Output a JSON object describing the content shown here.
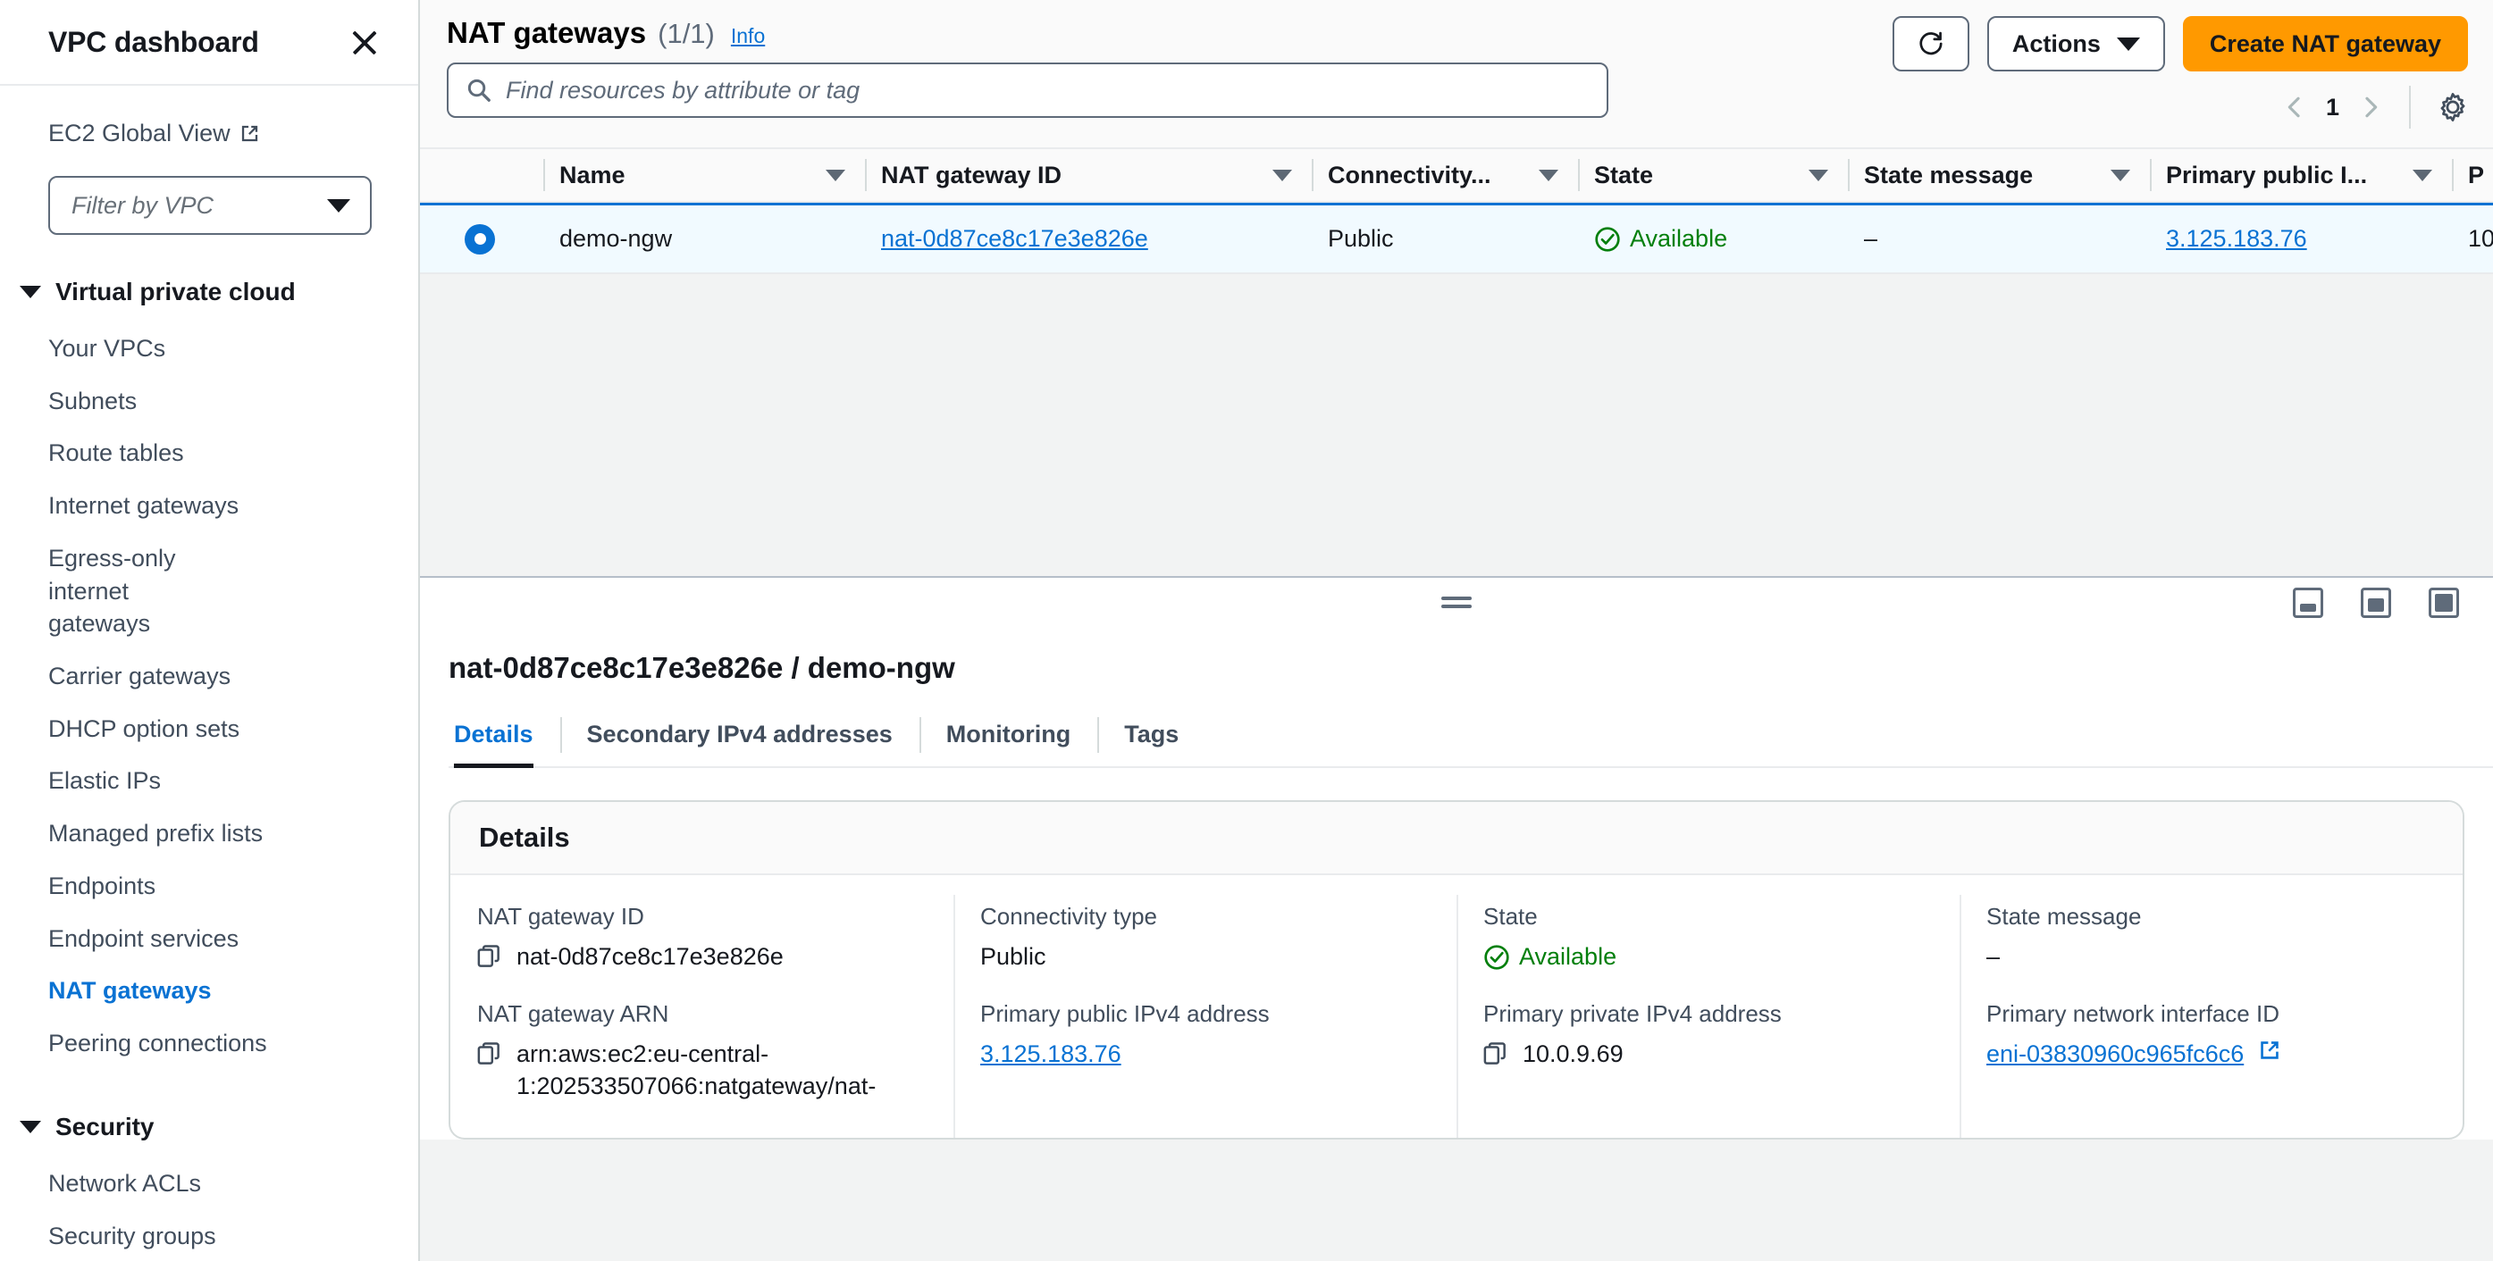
{
  "sidebar": {
    "title": "VPC dashboard",
    "close_label": "Close",
    "global_view": "EC2 Global View",
    "vpc_filter_placeholder": "Filter by VPC",
    "groups": [
      {
        "label": "Virtual private cloud",
        "items": [
          "Your VPCs",
          "Subnets",
          "Route tables",
          "Internet gateways",
          "Egress-only internet gateways",
          "Carrier gateways",
          "DHCP option sets",
          "Elastic IPs",
          "Managed prefix lists",
          "Endpoints",
          "Endpoint services",
          "NAT gateways",
          "Peering connections"
        ],
        "active": "NAT gateways"
      },
      {
        "label": "Security",
        "items": [
          "Network ACLs",
          "Security groups"
        ],
        "active": ""
      }
    ]
  },
  "header": {
    "title": "NAT gateways",
    "count": "(1/1)",
    "info_label": "Info",
    "search_placeholder": "Find resources by attribute or tag",
    "refresh_label": "refresh-icon",
    "actions_label": "Actions",
    "create_label": "Create NAT gateway",
    "page_number": "1",
    "settings_label": "settings-gear-icon"
  },
  "table": {
    "columns": [
      "Name",
      "NAT gateway ID",
      "Connectivity...",
      "State",
      "State message",
      "Primary public I...",
      "P"
    ],
    "rows": [
      {
        "selected": true,
        "name": "demo-ngw",
        "nat_gateway_id": "nat-0d87ce8c17e3e826e",
        "connectivity": "Public",
        "state": "Available",
        "state_message": "–",
        "primary_public_ip": "3.125.183.76",
        "primary_private_ip": "10"
      }
    ]
  },
  "detail": {
    "title": "nat-0d87ce8c17e3e826e / demo-ngw",
    "tabs": [
      {
        "label": "Details",
        "active": true
      },
      {
        "label": "Secondary IPv4 addresses",
        "active": false
      },
      {
        "label": "Monitoring",
        "active": false
      },
      {
        "label": "Tags",
        "active": false
      }
    ],
    "card_title": "Details",
    "fields": {
      "col1": [
        {
          "label": "NAT gateway ID",
          "value": "nat-0d87ce8c17e3e826e",
          "copy": true
        },
        {
          "label": "NAT gateway ARN",
          "value": "arn:aws:ec2:eu-central-1:202533507066:natgateway/nat-",
          "copy": true
        }
      ],
      "col2": [
        {
          "label": "Connectivity type",
          "value": "Public",
          "copy": false
        },
        {
          "label": "Primary public IPv4 address",
          "value": "3.125.183.76",
          "copy": false,
          "link": true
        }
      ],
      "col3": [
        {
          "label": "State",
          "value": "Available",
          "copy": false,
          "status": true
        },
        {
          "label": "Primary private IPv4 address",
          "value": "10.0.9.69",
          "copy": true
        }
      ],
      "col4": [
        {
          "label": "State message",
          "value": "–",
          "copy": false
        },
        {
          "label": "Primary network interface ID",
          "value": "eni-03830960c965fc6c6",
          "copy": false,
          "link": true,
          "external": true
        }
      ]
    }
  },
  "colors": {
    "accent": "#0972d3",
    "primary_button": "#ff9900",
    "success": "#037f0c",
    "text": "#16191f",
    "muted": "#414d5c"
  }
}
